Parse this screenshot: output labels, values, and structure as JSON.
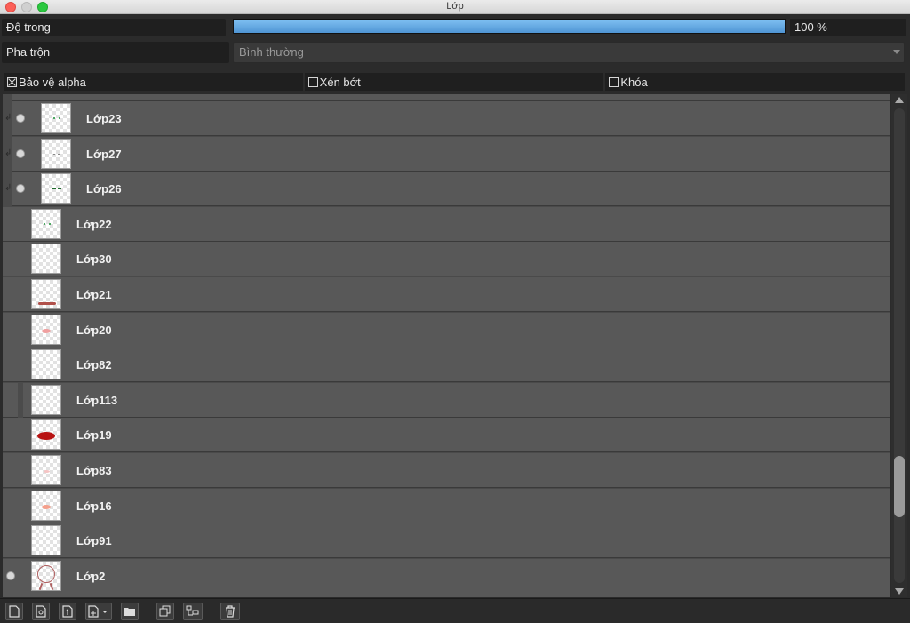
{
  "window": {
    "title": "Lớp"
  },
  "opacity": {
    "label": "Độ trong",
    "value_text": "100 %",
    "value": 100
  },
  "blend": {
    "label": "Pha trộn",
    "selected": "Bình thường"
  },
  "checkboxes": [
    {
      "label": "Bảo vệ alpha",
      "checked": true
    },
    {
      "label": "Xén bớt",
      "checked": false
    },
    {
      "label": "Khóa",
      "checked": false
    }
  ],
  "layers": [
    {
      "name": "Lớp23",
      "in_group": true,
      "visible": true,
      "thumb": "green-dots"
    },
    {
      "name": "Lớp27",
      "in_group": true,
      "visible": true,
      "thumb": "gray-dots"
    },
    {
      "name": "Lớp26",
      "in_group": true,
      "visible": true,
      "thumb": "dark-green-marks"
    },
    {
      "name": "Lớp22",
      "in_group": false,
      "visible": false,
      "thumb": "green-dots"
    },
    {
      "name": "Lớp30",
      "in_group": false,
      "visible": false,
      "thumb": "empty"
    },
    {
      "name": "Lớp21",
      "in_group": false,
      "visible": false,
      "thumb": "red-stroke"
    },
    {
      "name": "Lớp20",
      "in_group": false,
      "visible": false,
      "thumb": "pink-spot"
    },
    {
      "name": "Lớp82",
      "in_group": false,
      "visible": false,
      "thumb": "empty"
    },
    {
      "name": "Lớp113",
      "in_group": false,
      "visible": false,
      "thumb": "empty"
    },
    {
      "name": "Lớp19",
      "in_group": false,
      "visible": false,
      "thumb": "red-blob"
    },
    {
      "name": "Lớp83",
      "in_group": false,
      "visible": false,
      "thumb": "light-pink"
    },
    {
      "name": "Lớp16",
      "in_group": false,
      "visible": false,
      "thumb": "salmon-spot"
    },
    {
      "name": "Lớp91",
      "in_group": false,
      "visible": false,
      "thumb": "empty"
    },
    {
      "name": "Lớp2",
      "in_group": false,
      "visible": true,
      "thumb": "sketch-circle"
    }
  ],
  "scrollbar": {
    "position": 0.84,
    "visible_fraction": 0.13
  },
  "toolbar": [
    {
      "name": "new-layer-button",
      "icon": "new-page-icon"
    },
    {
      "name": "new-vector-layer-button",
      "icon": "new-vector-icon"
    },
    {
      "name": "new-text-layer-button",
      "icon": "new-1bit-icon"
    },
    {
      "name": "add-layer-menu-button",
      "icon": "add-dropdown-icon"
    },
    {
      "name": "new-folder-button",
      "icon": "folder-icon"
    },
    {
      "name": "duplicate-layer-button",
      "icon": "duplicate-icon"
    },
    {
      "name": "merge-down-button",
      "icon": "merge-icon"
    },
    {
      "name": "delete-layer-button",
      "icon": "trash-icon"
    }
  ],
  "colors": {
    "opacity_fill": "#5ba3e0",
    "row_bg": "#585858",
    "panel_bg": "#2b2b2b"
  }
}
